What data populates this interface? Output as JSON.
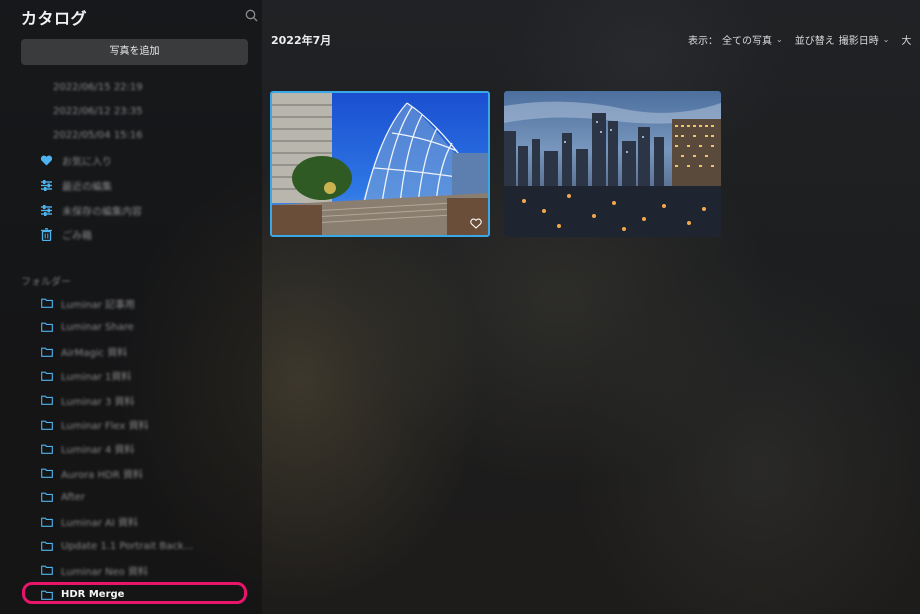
{
  "sidebar": {
    "title": "カタログ",
    "add_button": "写真を追加",
    "dates": [
      "2022/06/15 22:19",
      "2022/06/12 23:35",
      "2022/05/04 15:16"
    ],
    "nav": [
      {
        "label": "お気に入り",
        "icon": "heart-icon"
      },
      {
        "label": "最近の編集",
        "icon": "sliders-icon"
      },
      {
        "label": "未保存の編集内容",
        "icon": "sliders-icon"
      },
      {
        "label": "ごみ箱",
        "icon": "trash-icon"
      }
    ],
    "folders_header": "フォルダー",
    "folders": [
      "Luminar 記事用",
      "Luminar Share",
      "AirMagic 資料",
      "Luminar 1資料",
      "Luminar 3 資料",
      "Luminar Flex 資料",
      "Luminar 4 資料",
      "Aurora HDR 資料",
      "After",
      "Luminar AI 資料",
      "Update 1.1 Portrait Back...",
      "Luminar Neo 資料",
      "HDR Merge"
    ],
    "selected_folder": "HDR Merge"
  },
  "main": {
    "group_title": "2022年7月",
    "display_label": "表示：",
    "display_value": "全ての写真",
    "sort_label": "並び替え",
    "sort_value": "撮影日時",
    "size_label": "大"
  },
  "colors": {
    "accent": "#3aa8e6",
    "highlight": "#e8156a",
    "icon_blue": "#4fb3f0"
  }
}
